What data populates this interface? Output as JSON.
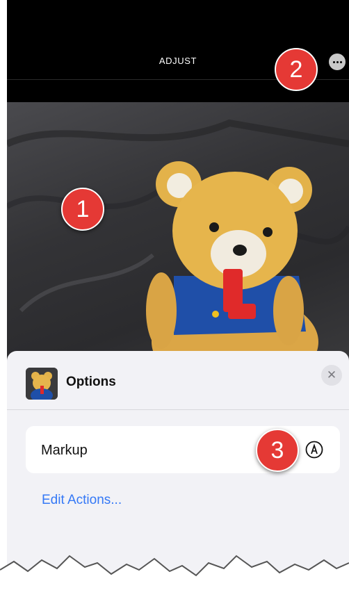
{
  "topbar": {
    "title": "ADJUST",
    "more_icon": "ellipsis-circle-icon"
  },
  "annotations": [
    {
      "label": "1"
    },
    {
      "label": "2"
    },
    {
      "label": "3"
    }
  ],
  "options_sheet": {
    "title": "Options",
    "close_icon": "close-icon",
    "actions": [
      {
        "label": "Markup",
        "icon": "markup-pen-icon"
      }
    ],
    "edit_link": "Edit Actions..."
  },
  "colors": {
    "badge": "#e53935",
    "link": "#3478f6",
    "sheet_bg": "#f2f2f6"
  }
}
